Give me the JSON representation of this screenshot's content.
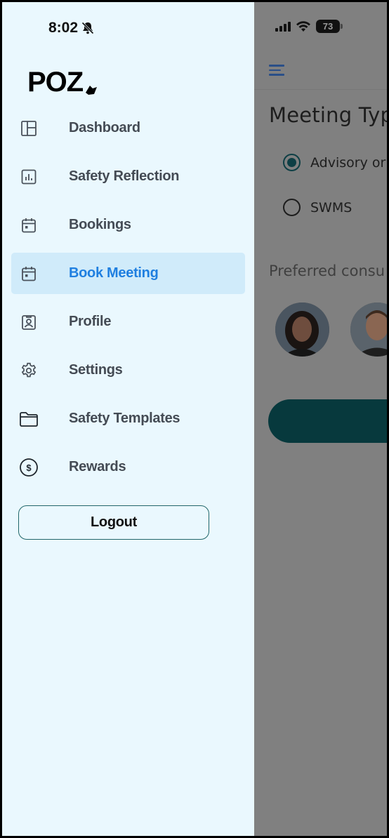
{
  "status_bar": {
    "time": "8:02",
    "battery": "73",
    "silent_icon": "bell-slash-icon",
    "signal_icon": "cellular-signal-icon",
    "wifi_icon": "wifi-icon"
  },
  "drawer": {
    "logo_text": "POZ",
    "items": [
      {
        "label": "Dashboard",
        "icon": "dashboard-icon",
        "active": false
      },
      {
        "label": "Safety Reflection",
        "icon": "chart-icon",
        "active": false
      },
      {
        "label": "Bookings",
        "icon": "calendar-icon",
        "active": false
      },
      {
        "label": "Book Meeting",
        "icon": "calendar-icon",
        "active": true
      },
      {
        "label": "Profile",
        "icon": "profile-badge-icon",
        "active": false
      },
      {
        "label": "Settings",
        "icon": "gear-icon",
        "active": false
      },
      {
        "label": "Safety Templates",
        "icon": "folder-icon",
        "active": false
      },
      {
        "label": "Rewards",
        "icon": "dollar-circle-icon",
        "active": false
      }
    ],
    "logout_label": "Logout"
  },
  "background_screen": {
    "title": "Meeting Typ",
    "meeting_types": [
      {
        "label": "Advisory or",
        "selected": true
      },
      {
        "label": "SWMS",
        "selected": false
      }
    ],
    "preferred_label": "Preferred consu",
    "menu_icon": "hamburger-icon"
  },
  "colors": {
    "drawer_bg": "#eaf8fe",
    "active_bg": "#d0ebfa",
    "active_text": "#1f7fe0",
    "accent": "#07393d",
    "overlay": "#808080"
  }
}
